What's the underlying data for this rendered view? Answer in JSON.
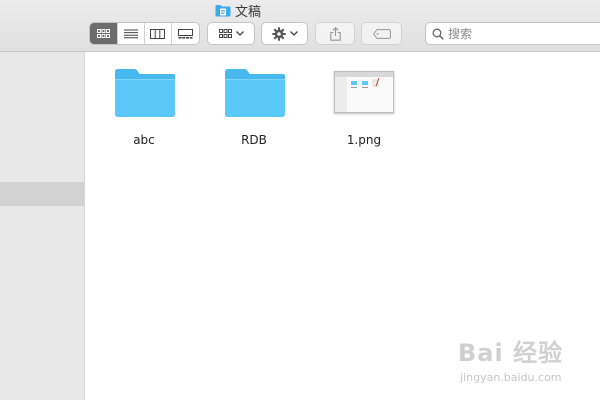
{
  "window": {
    "title": "文稿",
    "title_icon": "folder-doc-icon"
  },
  "toolbar": {
    "view_modes": [
      {
        "name": "icon-view",
        "icon": "grid-icon",
        "active": true
      },
      {
        "name": "list-view",
        "icon": "list-icon",
        "active": false
      },
      {
        "name": "column-view",
        "icon": "columns-icon",
        "active": false
      },
      {
        "name": "gallery-view",
        "icon": "gallery-icon",
        "active": false
      }
    ],
    "group_button": {
      "icon": "grid-icon",
      "dropdown_icon": "chevron-down-icon"
    },
    "action_button": {
      "icon": "gear-icon",
      "dropdown_icon": "chevron-down-icon"
    },
    "share_button": {
      "icon": "share-icon"
    },
    "tags_button": {
      "icon": "tag-icon"
    },
    "search": {
      "placeholder": "搜索",
      "value": "",
      "icon": "search-icon"
    }
  },
  "sidebar": {
    "selected_item": "unlabeled"
  },
  "files": [
    {
      "name": "abc",
      "kind": "folder"
    },
    {
      "name": "RDB",
      "kind": "folder"
    },
    {
      "name": "1.png",
      "kind": "image"
    }
  ],
  "colors": {
    "folder": "#5ac8f8",
    "folder_tab": "#48b8ee",
    "toolbar_bg": "#e6e6e6",
    "sidebar_bg": "#e8e8e8",
    "active_segment": "#6c6c6c"
  },
  "watermark": {
    "text": "Bai 经验",
    "sub": "jingyan.baidu.com"
  }
}
